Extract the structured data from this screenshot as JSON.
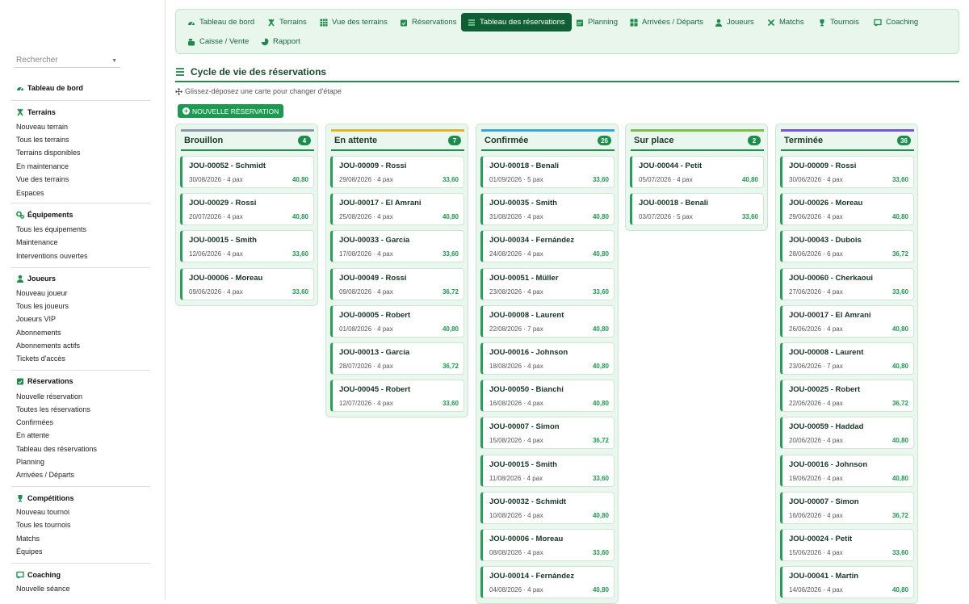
{
  "sidebar": {
    "search_placeholder": "Rechercher",
    "dashboard": "Tableau de bord",
    "sections": [
      {
        "title": "Terrains",
        "icon": "field-icon",
        "items": [
          "Nouveau terrain",
          "Tous les terrains",
          "Terrains disponibles",
          "En maintenance",
          "Vue des terrains",
          "Espaces"
        ]
      },
      {
        "title": "Équipements",
        "icon": "gears-icon",
        "items": [
          "Tous les équipements",
          "Maintenance",
          "Interventions ouvertes"
        ]
      },
      {
        "title": "Joueurs",
        "icon": "user-icon",
        "items": [
          "Nouveau joueur",
          "Tous les joueurs",
          "Joueurs VIP",
          "Abonnements",
          "Abonnements actifs",
          "Tickets d'accès"
        ]
      },
      {
        "title": "Réservations",
        "icon": "calendar-check-icon",
        "items": [
          "Nouvelle réservation",
          "Toutes les réservations",
          "Confirmées",
          "En attente",
          "Tableau des réservations",
          "Planning",
          "Arrivées / Départs"
        ]
      },
      {
        "title": "Compétitions",
        "icon": "trophy-icon",
        "items": [
          "Nouveau tournoi",
          "Tous les tournois",
          "Matchs",
          "Équipes"
        ]
      },
      {
        "title": "Coaching",
        "icon": "coaching-icon",
        "items": [
          "Nouvelle séance"
        ]
      }
    ]
  },
  "nav": {
    "tabs": [
      "Tableau de bord",
      "Terrains",
      "Vue des terrains",
      "Réservations",
      "Tableau des réservations",
      "Planning",
      "Arrivées / Départs",
      "Joueurs",
      "Matchs",
      "Tournois",
      "Coaching",
      "Caisse / Vente",
      "Rapport"
    ],
    "active": "Tableau des réservations"
  },
  "page": {
    "title": "Cycle de vie des réservations",
    "hint": "Glissez-déposez une carte pour changer d'étape",
    "new_button": "NOUVELLE RÉSERVATION"
  },
  "colors": {
    "brouillon": "#8a9aa6",
    "en_attente": "#e3b52b",
    "confirmee": "#38a7d8",
    "sur_place": "#7cc04a",
    "terminee": "#7a55d3"
  },
  "columns": [
    {
      "title": "Brouillon",
      "count": "4",
      "color_key": "brouillon",
      "cards": [
        {
          "id": "JOU-00052 - Schmidt",
          "meta": "30/08/2026 · 4 pax",
          "amount": "40,80"
        },
        {
          "id": "JOU-00029 - Rossi",
          "meta": "20/07/2026 · 4 pax",
          "amount": "40,80"
        },
        {
          "id": "JOU-00015 - Smith",
          "meta": "12/06/2026 · 4 pax",
          "amount": "33,60"
        },
        {
          "id": "JOU-00006 - Moreau",
          "meta": "09/06/2026 · 4 pax",
          "amount": "33,60"
        }
      ]
    },
    {
      "title": "En attente",
      "count": "7",
      "color_key": "en_attente",
      "cards": [
        {
          "id": "JOU-00009 - Rossi",
          "meta": "29/08/2026 · 4 pax",
          "amount": "33,60"
        },
        {
          "id": "JOU-00017 - El Amrani",
          "meta": "25/08/2026 · 4 pax",
          "amount": "40,80"
        },
        {
          "id": "JOU-00033 - García",
          "meta": "17/08/2026 · 4 pax",
          "amount": "33,60"
        },
        {
          "id": "JOU-00049 - Rossi",
          "meta": "09/08/2026 · 4 pax",
          "amount": "36,72"
        },
        {
          "id": "JOU-00005 - Robert",
          "meta": "01/08/2026 · 4 pax",
          "amount": "40,80"
        },
        {
          "id": "JOU-00013 - García",
          "meta": "28/07/2026 · 4 pax",
          "amount": "36,72"
        },
        {
          "id": "JOU-00045 - Robert",
          "meta": "12/07/2026 · 4 pax",
          "amount": "33,60"
        }
      ]
    },
    {
      "title": "Confirmée",
      "count": "26",
      "color_key": "confirmee",
      "cards": [
        {
          "id": "JOU-00018 - Benali",
          "meta": "01/09/2026 · 5 pax",
          "amount": "33,60"
        },
        {
          "id": "JOU-00035 - Smith",
          "meta": "31/08/2026 · 4 pax",
          "amount": "40,80"
        },
        {
          "id": "JOU-00034 - Fernández",
          "meta": "24/08/2026 · 4 pax",
          "amount": "40,80"
        },
        {
          "id": "JOU-00051 - Müller",
          "meta": "23/08/2026 · 4 pax",
          "amount": "33,60"
        },
        {
          "id": "JOU-00008 - Laurent",
          "meta": "22/08/2026 · 7 pax",
          "amount": "40,80"
        },
        {
          "id": "JOU-00016 - Johnson",
          "meta": "18/08/2026 · 4 pax",
          "amount": "40,80"
        },
        {
          "id": "JOU-00050 - Bianchi",
          "meta": "16/08/2026 · 4 pax",
          "amount": "40,80"
        },
        {
          "id": "JOU-00007 - Simon",
          "meta": "15/08/2026 · 4 pax",
          "amount": "36,72"
        },
        {
          "id": "JOU-00015 - Smith",
          "meta": "11/08/2026 · 4 pax",
          "amount": "33,60"
        },
        {
          "id": "JOU-00032 - Schmidt",
          "meta": "10/08/2026 · 4 pax",
          "amount": "40,80"
        },
        {
          "id": "JOU-00006 - Moreau",
          "meta": "08/08/2026 · 4 pax",
          "amount": "33,60"
        },
        {
          "id": "JOU-00014 - Fernández",
          "meta": "04/08/2026 · 4 pax",
          "amount": "40,80"
        }
      ]
    },
    {
      "title": "Sur place",
      "count": "2",
      "color_key": "sur_place",
      "cards": [
        {
          "id": "JOU-00044 - Petit",
          "meta": "05/07/2026 · 4 pax",
          "amount": "40,80"
        },
        {
          "id": "JOU-00018 - Benali",
          "meta": "03/07/2026 · 5 pax",
          "amount": "33,60"
        }
      ]
    },
    {
      "title": "Terminée",
      "count": "36",
      "color_key": "terminee",
      "cards": [
        {
          "id": "JOU-00009 - Rossi",
          "meta": "30/06/2026 · 4 pax",
          "amount": "33,60"
        },
        {
          "id": "JOU-00026 - Moreau",
          "meta": "29/06/2026 · 4 pax",
          "amount": "40,80"
        },
        {
          "id": "JOU-00043 - Dubois",
          "meta": "28/06/2026 · 6 pax",
          "amount": "36,72"
        },
        {
          "id": "JOU-00060 - Cherkaoui",
          "meta": "27/06/2026 · 4 pax",
          "amount": "33,60"
        },
        {
          "id": "JOU-00017 - El Amrani",
          "meta": "26/06/2026 · 4 pax",
          "amount": "40,80"
        },
        {
          "id": "JOU-00008 - Laurent",
          "meta": "23/06/2026 · 7 pax",
          "amount": "40,80"
        },
        {
          "id": "JOU-00025 - Robert",
          "meta": "22/06/2026 · 4 pax",
          "amount": "36,72"
        },
        {
          "id": "JOU-00059 - Haddad",
          "meta": "20/06/2026 · 4 pax",
          "amount": "40,80"
        },
        {
          "id": "JOU-00016 - Johnson",
          "meta": "19/06/2026 · 4 pax",
          "amount": "40,80"
        },
        {
          "id": "JOU-00007 - Simon",
          "meta": "16/06/2026 · 4 pax",
          "amount": "36,72"
        },
        {
          "id": "JOU-00024 - Petit",
          "meta": "15/06/2026 · 4 pax",
          "amount": "33,60"
        },
        {
          "id": "JOU-00041 - Martin",
          "meta": "14/06/2026 · 4 pax",
          "amount": "40,80"
        }
      ]
    }
  ]
}
